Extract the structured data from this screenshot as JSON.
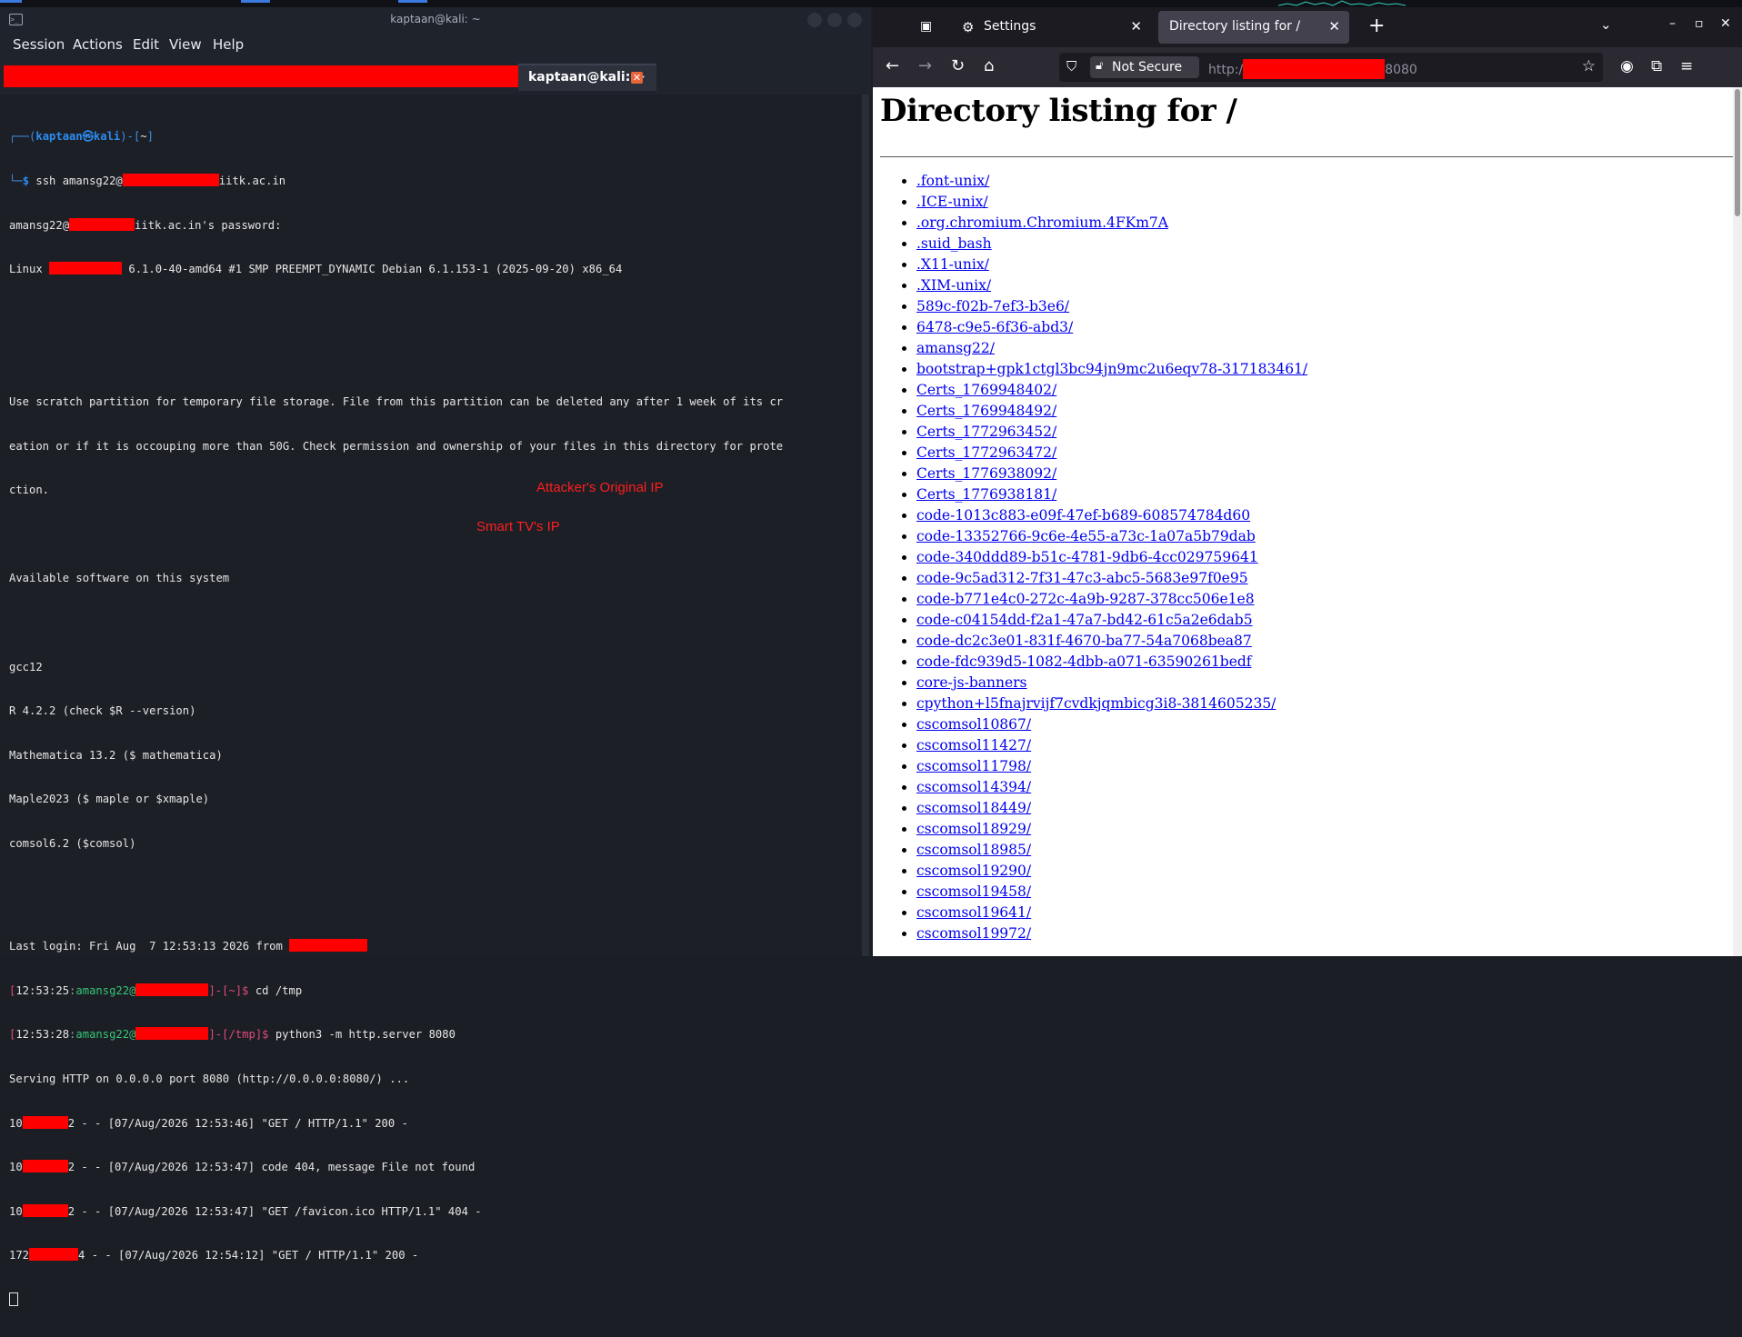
{
  "terminal": {
    "window_title": "kaptaan@kali: ~",
    "menu": [
      "Session",
      "Actions",
      "Edit",
      "View",
      "Help"
    ],
    "tab_label": "kaptaan@kali: ~",
    "tab_close": "✕",
    "prompt": {
      "corner_top": "┌──(",
      "user": "kaptaan",
      "at_symbol": "㉿",
      "host": "kali",
      "path_open": ")-[",
      "path": "~",
      "path_close": "]",
      "corner_bottom": "└─",
      "dollar": "$ "
    },
    "ssh_cmd_pre": "ssh amansg22@",
    "ssh_cmd_post": "iitk.ac.in",
    "pwd_pre": "amansg22@",
    "pwd_post": "iitk.ac.in's password:",
    "linux_pre": "Linux ",
    "linux_post": " 6.1.0-40-amd64 #1 SMP PREEMPT_DYNAMIC Debian 6.1.153-1 (2025-09-20) x86_64",
    "motd_1": "Use scratch partition for temporary file storage. File from this partition can be deleted any after 1 week of its cr",
    "motd_2": "eation or if it is occouping more than 50G. Check permission and ownership of your files in this directory for prote",
    "motd_3": "ction.",
    "available": "Available software on this system",
    "software": [
      "gcc12",
      "R 4.2.2 (check $R --version)",
      "Mathematica 13.2 ($ mathematica)",
      "Maple2023 ($ maple or $xmaple)",
      "comsol6.2 ($comsol)"
    ],
    "last_login": "Last login: Fri Aug  7 12:53:13 2026 from ",
    "cmd1": {
      "lb": "[",
      "time": "12:53:25",
      "colon": ":",
      "user": "amansg22@",
      "mid": "]-[",
      "path": "~",
      "end": "]$ ",
      "cmd": "cd /tmp"
    },
    "cmd2": {
      "lb": "[",
      "time": "12:53:28",
      "colon": ":",
      "user": "amansg22@",
      "mid": "]-[",
      "path": "/tmp",
      "end": "]$ ",
      "cmd": "python3 -m http.server 8080"
    },
    "serving": "Serving HTTP on 0.0.0.0 port 8080 (http://0.0.0.0:8080/) ...",
    "log": [
      {
        "pre": "10",
        "mid": "2",
        "rest": " - - [07/Aug/2026 12:53:46] \"GET / HTTP/1.1\" 200 -"
      },
      {
        "pre": "10",
        "mid": "2",
        "rest": " - - [07/Aug/2026 12:53:47] code 404, message File not found"
      },
      {
        "pre": "10",
        "mid": "2",
        "rest": " - - [07/Aug/2026 12:53:47] \"GET /favicon.ico HTTP/1.1\" 404 -"
      },
      {
        "pre": "172",
        "mid": "4",
        "rest": " - - [07/Aug/2026 12:54:12] \"GET / HTTP/1.1\" 200 -"
      }
    ],
    "annotations": {
      "attacker": "Attacker's Original IP",
      "tv": "Smart TV's IP"
    }
  },
  "browser": {
    "tabs": [
      {
        "label": "Settings",
        "icon": "gear-icon",
        "active": false
      },
      {
        "label": "Directory listing for /",
        "active": true
      }
    ],
    "close_glyph": "✕",
    "not_secure": "Not Secure",
    "url_prefix": "http:/",
    "url_suffix": "8080",
    "page": {
      "heading": "Directory listing for /",
      "entries": [
        ".font-unix/",
        ".ICE-unix/",
        ".org.chromium.Chromium.4FKm7A",
        ".suid_bash",
        ".X11-unix/",
        ".XIM-unix/",
        "589c-f02b-7ef3-b3e6/",
        "6478-c9e5-6f36-abd3/",
        "amansg22/",
        "bootstrap+gpk1ctgl3bc94jn9mc2u6eqv78-317183461/",
        "Certs_1769948402/",
        "Certs_1769948492/",
        "Certs_1772963452/",
        "Certs_1772963472/",
        "Certs_1776938092/",
        "Certs_1776938181/",
        "code-1013c883-e09f-47ef-b689-608574784d60",
        "code-13352766-9c6e-4e55-a73c-1a07a5b79dab",
        "code-340ddd89-b51c-4781-9db6-4cc029759641",
        "code-9c5ad312-7f31-47c3-abc5-5683e97f0e95",
        "code-b771e4c0-272c-4a9b-9287-378cc506e1e8",
        "code-c04154dd-f2a1-47a7-bd42-61c5a2e6dab5",
        "code-dc2c3e01-831f-4670-ba77-54a7068bea87",
        "code-fdc939d5-1082-4dbb-a071-63590261bedf",
        "core-js-banners",
        "cpython+l5fnajrvijf7cvdkjqmbicg3i8-3814605235/",
        "cscomsol10867/",
        "cscomsol11427/",
        "cscomsol11798/",
        "cscomsol14394/",
        "cscomsol18449/",
        "cscomsol18929/",
        "cscomsol18985/",
        "cscomsol19290/",
        "cscomsol19458/",
        "cscomsol19641/",
        "cscomsol19972/"
      ]
    }
  },
  "colors": {
    "redaction": "#fe0000",
    "link": "#0000ee",
    "prompt_blue": "#2d8cf0",
    "annotation": "#fe1e1e"
  }
}
